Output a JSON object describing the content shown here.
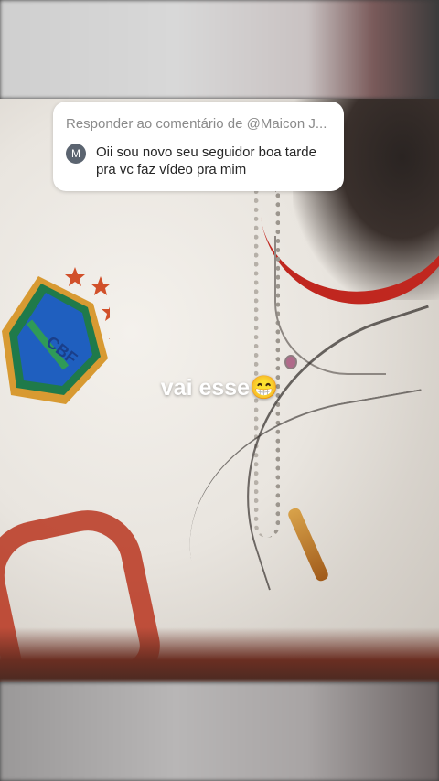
{
  "reply_card": {
    "header": "Responder ao comentário de @Maicon J...",
    "avatar_letter": "M",
    "comment": "Oii sou novo seu seguidor boa tarde pra vc faz vídeo pra mim"
  },
  "caption": {
    "text": "vai esse",
    "emoji": "😁"
  },
  "crest": {
    "letters": "CBF"
  },
  "colors": {
    "caption_text": "#ffffff",
    "card_bg": "#ffffff",
    "header_text": "#8a8a8a",
    "comment_text": "#262626",
    "avatar_bg": "#5b6470"
  }
}
